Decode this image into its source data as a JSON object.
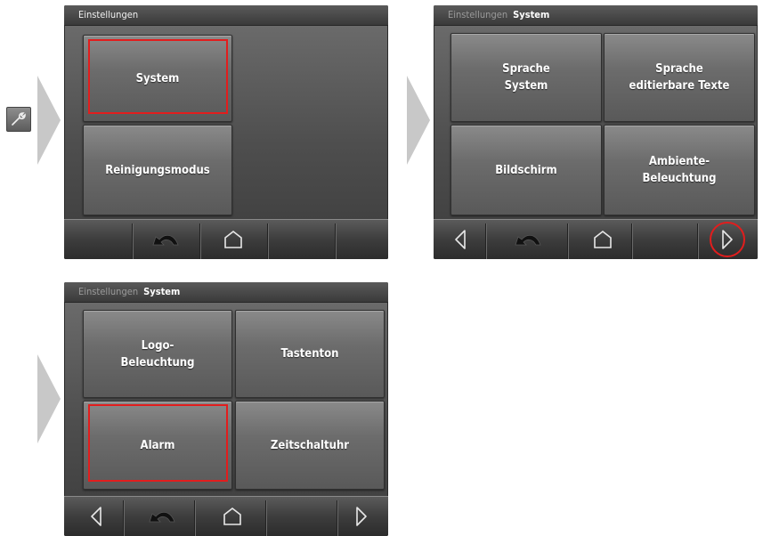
{
  "sidebar": {
    "icon": "wrench-icon"
  },
  "screens": [
    {
      "breadcrumb": {
        "parent": "",
        "current": "Einstellungen"
      },
      "tiles": [
        "System",
        "Reinigungsmodus"
      ],
      "nav": [
        "back-icon",
        "home-icon"
      ]
    },
    {
      "breadcrumb": {
        "parent": "Einstellungen",
        "current": "System"
      },
      "tiles": [
        "Sprache\nSystem",
        "Sprache\neditierbare Texte",
        "Bildschirm",
        "Ambiente-\nBeleuchtung"
      ],
      "nav": [
        "prev-icon",
        "back-icon",
        "home-icon",
        "next-icon"
      ]
    },
    {
      "breadcrumb": {
        "parent": "Einstellungen",
        "current": "System"
      },
      "tiles": [
        "Logo-\nBeleuchtung",
        "Tastenton",
        "Alarm",
        "Zeitschaltuhr"
      ],
      "nav": [
        "prev-icon",
        "back-icon",
        "home-icon",
        "next-icon"
      ]
    }
  ],
  "colors": {
    "highlight": "#e21d1d",
    "flow_arrow": "#c8c8c8"
  }
}
